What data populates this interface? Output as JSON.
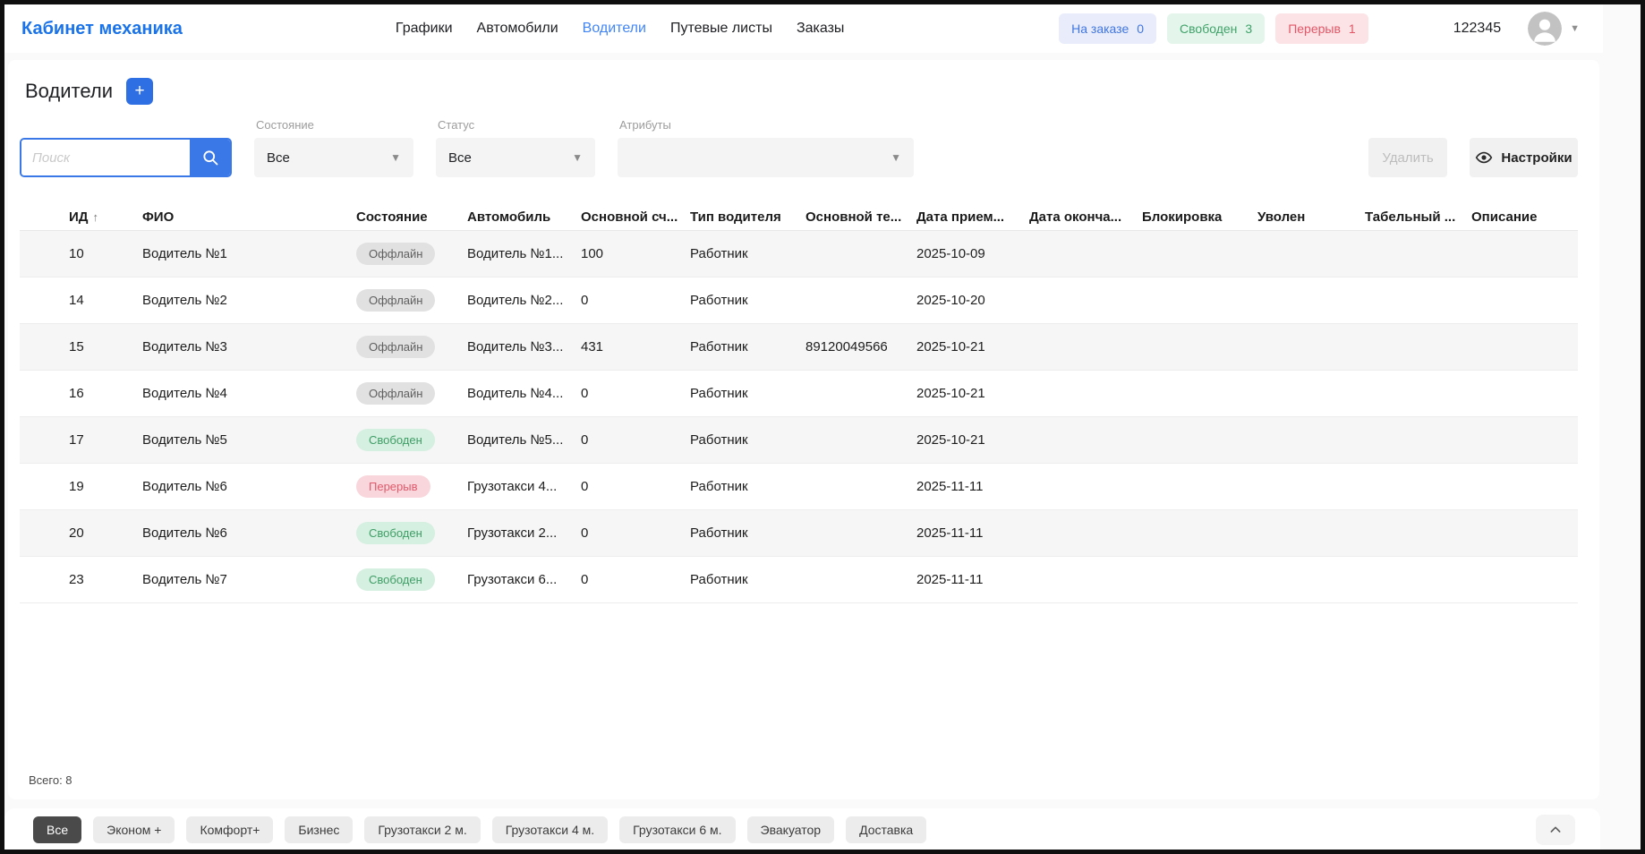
{
  "header": {
    "logo": "Кабинет механика",
    "nav": [
      {
        "label": "Графики",
        "active": false
      },
      {
        "label": "Автомобили",
        "active": false
      },
      {
        "label": "Водители",
        "active": true
      },
      {
        "label": "Путевые листы",
        "active": false
      },
      {
        "label": "Заказы",
        "active": false
      }
    ],
    "counters": [
      {
        "label": "На заказе",
        "value": "0",
        "color": "blue"
      },
      {
        "label": "Свободен",
        "value": "3",
        "color": "green"
      },
      {
        "label": "Перерыв",
        "value": "1",
        "color": "red"
      }
    ],
    "account_id": "122345"
  },
  "toolbar": {
    "title": "Водители",
    "add_label": "+",
    "search_placeholder": "Поиск",
    "filters": {
      "state": {
        "label": "Состояние",
        "value": "Все"
      },
      "status": {
        "label": "Статус",
        "value": "Все"
      },
      "attributes": {
        "label": "Атрибуты",
        "value": ""
      }
    },
    "delete_label": "Удалить",
    "settings_label": "Настройки"
  },
  "table": {
    "columns": [
      "ИД",
      "ФИО",
      "Состояние",
      "Автомобиль",
      "Основной сч...",
      "Тип водителя",
      "Основной те...",
      "Дата прием...",
      "Дата оконча...",
      "Блокировка",
      "Уволен",
      "Табельный ...",
      "Описание"
    ],
    "sort": {
      "column": "ИД",
      "direction": "asc",
      "icon": "arrow-up"
    },
    "rows": [
      {
        "id": "10",
        "name": "Водитель №1",
        "state": {
          "label": "Оффлайн",
          "type": "offline"
        },
        "car": "Водитель №1...",
        "account": "100",
        "driver_type": "Работник",
        "phone": "",
        "hire_date": "2025-10-09",
        "end_date": "",
        "block": "",
        "fired": "",
        "tab_number": "",
        "description": ""
      },
      {
        "id": "14",
        "name": "Водитель №2",
        "state": {
          "label": "Оффлайн",
          "type": "offline"
        },
        "car": "Водитель №2...",
        "account": "0",
        "driver_type": "Работник",
        "phone": "",
        "hire_date": "2025-10-20",
        "end_date": "",
        "block": "",
        "fired": "",
        "tab_number": "",
        "description": ""
      },
      {
        "id": "15",
        "name": "Водитель №3",
        "state": {
          "label": "Оффлайн",
          "type": "offline"
        },
        "car": "Водитель №3...",
        "account": "431",
        "driver_type": "Работник",
        "phone": "89120049566",
        "hire_date": "2025-10-21",
        "end_date": "",
        "block": "",
        "fired": "",
        "tab_number": "",
        "description": ""
      },
      {
        "id": "16",
        "name": "Водитель №4",
        "state": {
          "label": "Оффлайн",
          "type": "offline"
        },
        "car": "Водитель №4...",
        "account": "0",
        "driver_type": "Работник",
        "phone": "",
        "hire_date": "2025-10-21",
        "end_date": "",
        "block": "",
        "fired": "",
        "tab_number": "",
        "description": ""
      },
      {
        "id": "17",
        "name": "Водитель №5",
        "state": {
          "label": "Свободен",
          "type": "free"
        },
        "car": "Водитель №5...",
        "account": "0",
        "driver_type": "Работник",
        "phone": "",
        "hire_date": "2025-10-21",
        "end_date": "",
        "block": "",
        "fired": "",
        "tab_number": "",
        "description": ""
      },
      {
        "id": "19",
        "name": "Водитель №6",
        "state": {
          "label": "Перерыв",
          "type": "break"
        },
        "car": "Грузотакси 4...",
        "account": "0",
        "driver_type": "Работник",
        "phone": "",
        "hire_date": "2025-11-11",
        "end_date": "",
        "block": "",
        "fired": "",
        "tab_number": "",
        "description": ""
      },
      {
        "id": "20",
        "name": "Водитель №6",
        "state": {
          "label": "Свободен",
          "type": "free"
        },
        "car": "Грузотакси 2...",
        "account": "0",
        "driver_type": "Работник",
        "phone": "",
        "hire_date": "2025-11-11",
        "end_date": "",
        "block": "",
        "fired": "",
        "tab_number": "",
        "description": ""
      },
      {
        "id": "23",
        "name": "Водитель №7",
        "state": {
          "label": "Свободен",
          "type": "free"
        },
        "car": "Грузотакси 6...",
        "account": "0",
        "driver_type": "Работник",
        "phone": "",
        "hire_date": "2025-11-11",
        "end_date": "",
        "block": "",
        "fired": "",
        "tab_number": "",
        "description": ""
      }
    ],
    "total": "Всего: 8"
  },
  "footer": {
    "chips": [
      {
        "label": "Все",
        "active": true
      },
      {
        "label": "Эконом +",
        "active": false
      },
      {
        "label": "Комфорт+",
        "active": false
      },
      {
        "label": "Бизнес",
        "active": false
      },
      {
        "label": "Грузотакси 2 м.",
        "active": false
      },
      {
        "label": "Грузотакси 4 м.",
        "active": false
      },
      {
        "label": "Грузотакси 6 м.",
        "active": false
      },
      {
        "label": "Эвакуатор",
        "active": false
      },
      {
        "label": "Доставка",
        "active": false
      }
    ]
  },
  "colors": {
    "accent": "#2f6fe4",
    "logo_blue": "#1a73e8",
    "nav_active": "#4285f4",
    "badge_blue_bg": "#e9edfb",
    "badge_blue_fg": "#4176e0",
    "badge_green_bg": "#e4f5ec",
    "badge_green_fg": "#3fa268",
    "badge_red_bg": "#fbe3e6",
    "badge_red_fg": "#e25767",
    "pill_gray_bg": "#e1e1e1",
    "pill_gray_fg": "#5f5f5f",
    "pill_green_bg": "#d5efe0",
    "pill_green_fg": "#3f9e66",
    "pill_red_bg": "#f8d6db",
    "pill_red_fg": "#e05a6c",
    "chip_dark": "#4a4a4a"
  }
}
